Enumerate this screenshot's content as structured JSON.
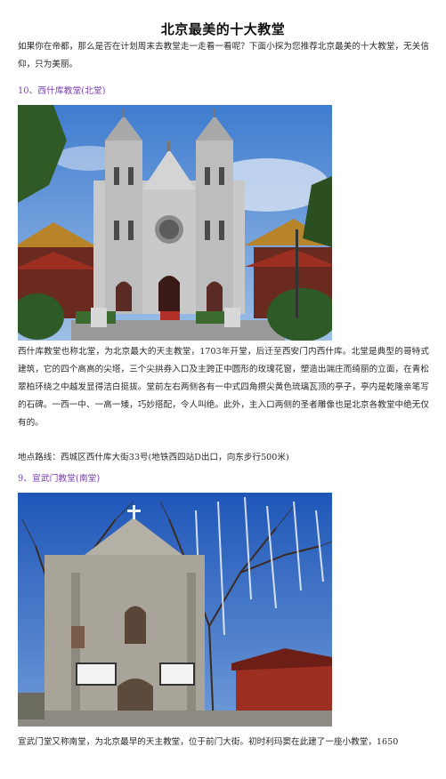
{
  "title": "北京最美的十大教堂",
  "intro": "如果你在帝都，那么是否在计划周末去教堂走一走看一看呢？下面小探为您推荐北京最美的十大教堂，无关信仰，只为美丽。",
  "sections": [
    {
      "heading": "10、西什库教堂(北堂)",
      "description": "西什库教堂也称北堂，为北京最大的天主教堂，1703年开堂，后迁至西安门内西什库。北堂是典型的哥特式建筑，它的四个高高的尖塔，三个尖拱券入口及主跨正中圆形的玫瑰花窗，塑造出端庄而绮丽的立面，在青松翠柏环绕之中越发显得洁白挺拔。堂前左右两侧各有一中式四角攒尖黄色琉璃瓦顶的亭子，亭内是乾隆亲笔写的石碑。一西一中、一高一矮，巧妙搭配，令人叫绝。此外，主入口两侧的圣者雕像也是北京各教堂中绝无仅有的。",
      "route": "地点路线：西城区西什库大街33号(地铁西四站D出口，向东步行500米)"
    },
    {
      "heading": "9、宣武门教堂(南堂)",
      "description": "宣武门堂又称南堂，为北京最早的天主教堂，位于前门大街。初时利玛窦在此建了一座小教堂，1650"
    }
  ],
  "colors": {
    "heading": "#7a3fb0",
    "sky": "#4f86d4",
    "cathedral_stone": "#c9c9c9",
    "pavilion_red": "#9c2f22"
  }
}
